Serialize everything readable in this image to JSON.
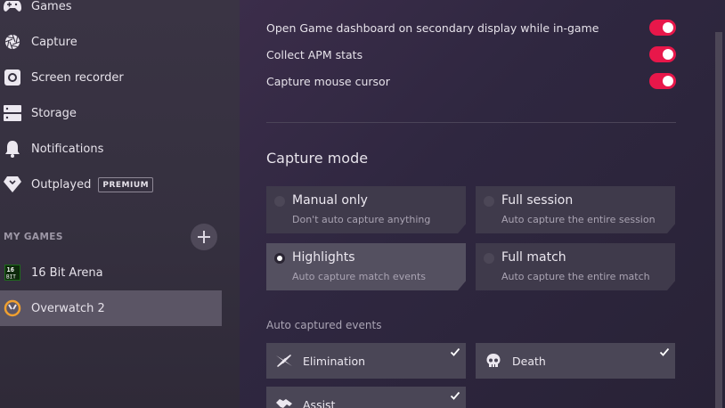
{
  "sidebar": {
    "items": [
      {
        "label": "Games",
        "icon": "gamepad-icon"
      },
      {
        "label": "Capture",
        "icon": "aperture-icon"
      },
      {
        "label": "Screen recorder",
        "icon": "record-icon"
      },
      {
        "label": "Storage",
        "icon": "storage-icon"
      },
      {
        "label": "Notifications",
        "icon": "bell-icon"
      },
      {
        "label": "Outplayed",
        "icon": "outplayed-diamond-icon",
        "badge": "PREMIUM"
      }
    ],
    "section_label": "MY GAMES",
    "games": [
      {
        "label": "16 Bit Arena",
        "icon": "16bit-arena-icon",
        "active": false
      },
      {
        "label": "Overwatch 2",
        "icon": "overwatch-icon",
        "active": true
      }
    ]
  },
  "settings": {
    "toggles": [
      {
        "label": "Open Game dashboard on secondary display while in-game",
        "on": true
      },
      {
        "label": "Collect APM stats",
        "on": true
      },
      {
        "label": "Capture mouse cursor",
        "on": true
      }
    ],
    "capture_mode": {
      "heading": "Capture mode",
      "options": [
        {
          "title": "Manual only",
          "subtitle": "Don't auto capture anything",
          "selected": false
        },
        {
          "title": "Full session",
          "subtitle": "Auto capture the entire session",
          "selected": false
        },
        {
          "title": "Highlights",
          "subtitle": "Auto capture match events",
          "selected": true
        },
        {
          "title": "Full match",
          "subtitle": "Auto capture the entire match",
          "selected": false
        }
      ]
    },
    "events": {
      "heading": "Auto captured events",
      "items": [
        {
          "label": "Elimination",
          "icon": "crossed-guns-icon",
          "checked": true
        },
        {
          "label": "Death",
          "icon": "skull-icon",
          "checked": true
        },
        {
          "label": "Assist",
          "icon": "handshake-icon",
          "checked": true
        }
      ]
    }
  },
  "colors": {
    "accent": "#e8174a",
    "sidebar_active": "#5b5565"
  }
}
